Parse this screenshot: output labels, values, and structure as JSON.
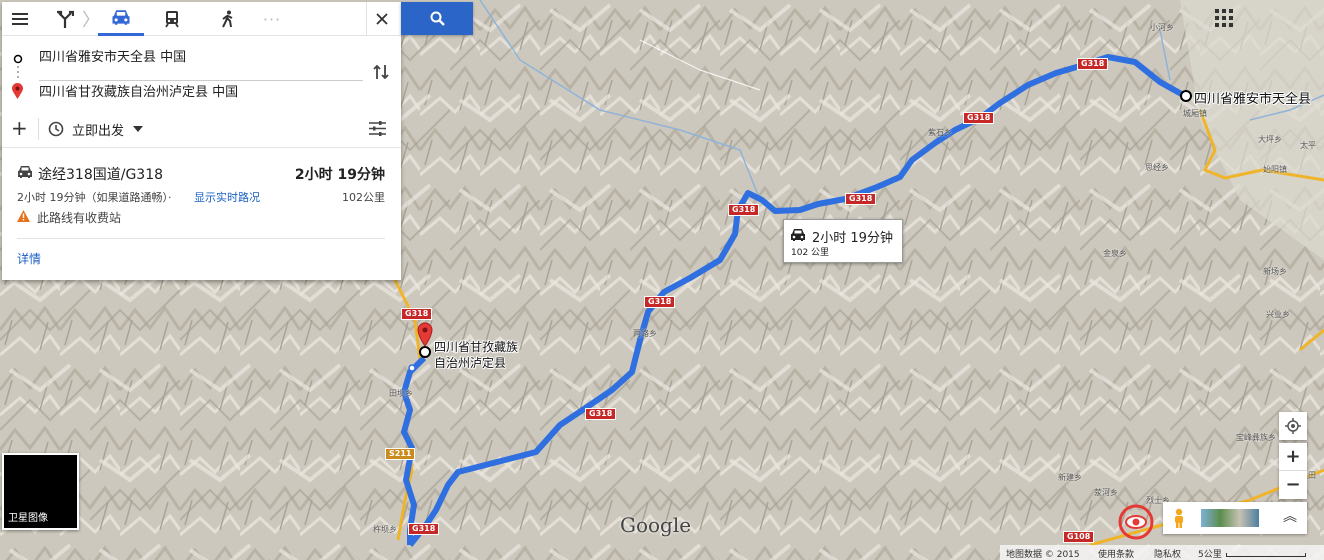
{
  "topbar": {
    "menu_icon": "menu-icon",
    "modes": [
      "directions-icon",
      "car-icon",
      "transit-icon",
      "walk-icon",
      "more-icon"
    ],
    "close_icon": "close-icon",
    "search_icon": "search-icon"
  },
  "waypoints": {
    "origin": "四川省雅安市天全县 中国",
    "destination": "四川省甘孜藏族自治州泸定县 中国"
  },
  "options": {
    "depart_label": "立即出发",
    "add_icon": "plus-icon",
    "settings_icon": "sliders-icon"
  },
  "route": {
    "via": "途经318国道/G318",
    "duration": "2小时 19分钟",
    "sub_duration": "2小时 19分钟（如果道路通畅）·",
    "traffic_link": "显示实时路况",
    "distance": "102公里",
    "toll_warning": "此路线有收费站",
    "details_link": "详情"
  },
  "map": {
    "callout_time": "2小时 19分钟",
    "callout_distance": "102 公里",
    "origin_label": "四川省雅安市天全县",
    "dest_label_line1": "四川省甘孜藏族",
    "dest_label_line2": "自治州泸定县",
    "google_logo": "Google",
    "satellite_label": "卫星图像",
    "route_color": "#2f6fe0",
    "shields": [
      "G318",
      "G318",
      "G318",
      "G318",
      "G318",
      "G318",
      "G318",
      "S211",
      "G318",
      "G108"
    ],
    "places": [
      "小河乡",
      "城厢镇",
      "大坪乡",
      "始阳镇",
      "思经乡",
      "紫石乡",
      "金泉乡",
      "新场乡",
      "兴业乡",
      "两路乡",
      "田坝乡",
      "宝峰彝族乡",
      "新建乡",
      "荥河乡",
      "烈士乡",
      "杵坝乡",
      "大田",
      "太平"
    ]
  },
  "footer": {
    "map_data": "地图数据 © 2015",
    "terms": "使用条款",
    "privacy": "隐私权",
    "scale": "5公里"
  }
}
